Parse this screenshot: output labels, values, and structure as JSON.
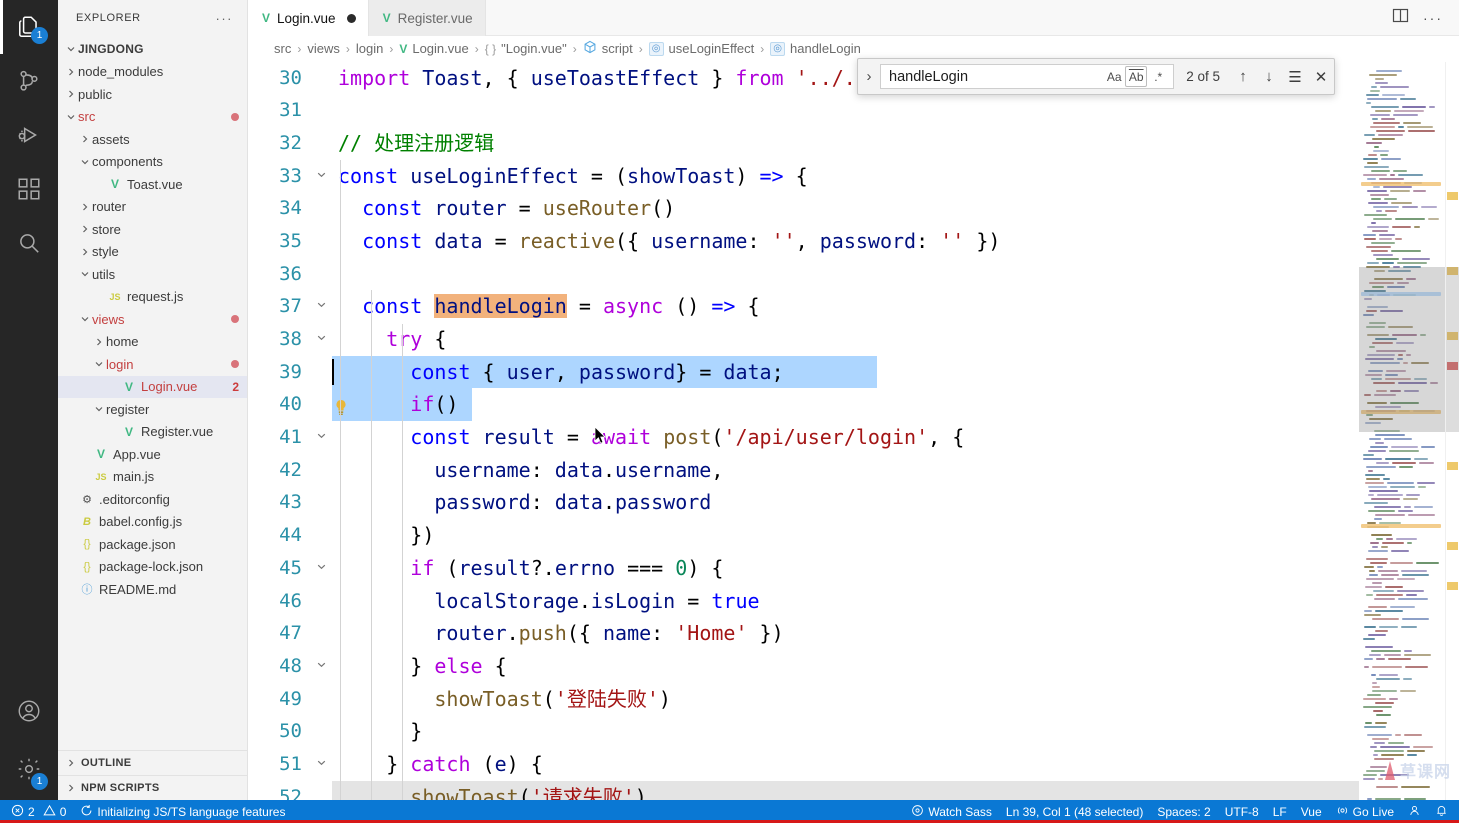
{
  "activitybar": {
    "items": [
      {
        "name": "explorer",
        "icon": "files-icon",
        "badge": "1",
        "active": true
      },
      {
        "name": "source-control",
        "icon": "source-control-icon",
        "badge": "",
        "active": false
      },
      {
        "name": "run-debug",
        "icon": "run-debug-icon",
        "badge": "",
        "active": false
      },
      {
        "name": "extensions",
        "icon": "extensions-icon",
        "badge": "",
        "active": false
      },
      {
        "name": "search",
        "icon": "search-icon",
        "badge": "",
        "active": false
      }
    ],
    "bottom": [
      {
        "name": "account",
        "icon": "account-icon",
        "badge": ""
      },
      {
        "name": "settings",
        "icon": "gear-icon",
        "badge": "1"
      }
    ]
  },
  "sidebar": {
    "title": "EXPLORER",
    "more_label": "···",
    "root": "JINGDONG",
    "tree": [
      {
        "label": "node_modules",
        "indent": 1,
        "arrow": "collapsed",
        "icon": "",
        "dirty": false,
        "selected": false,
        "count": ""
      },
      {
        "label": "public",
        "indent": 1,
        "arrow": "collapsed",
        "icon": "",
        "dirty": false,
        "selected": false,
        "count": ""
      },
      {
        "label": "src",
        "indent": 1,
        "arrow": "expanded",
        "icon": "",
        "dirty": true,
        "selected": false,
        "count": "",
        "modified": true
      },
      {
        "label": "assets",
        "indent": 2,
        "arrow": "collapsed",
        "icon": "",
        "dirty": false,
        "selected": false,
        "count": ""
      },
      {
        "label": "components",
        "indent": 2,
        "arrow": "expanded",
        "icon": "",
        "dirty": false,
        "selected": false,
        "count": ""
      },
      {
        "label": "Toast.vue",
        "indent": 3,
        "arrow": "none",
        "icon": "vue",
        "dirty": false,
        "selected": false,
        "count": ""
      },
      {
        "label": "router",
        "indent": 2,
        "arrow": "collapsed",
        "icon": "",
        "dirty": false,
        "selected": false,
        "count": ""
      },
      {
        "label": "store",
        "indent": 2,
        "arrow": "collapsed",
        "icon": "",
        "dirty": false,
        "selected": false,
        "count": ""
      },
      {
        "label": "style",
        "indent": 2,
        "arrow": "collapsed",
        "icon": "",
        "dirty": false,
        "selected": false,
        "count": ""
      },
      {
        "label": "utils",
        "indent": 2,
        "arrow": "expanded",
        "icon": "",
        "dirty": false,
        "selected": false,
        "count": ""
      },
      {
        "label": "request.js",
        "indent": 3,
        "arrow": "none",
        "icon": "js",
        "dirty": false,
        "selected": false,
        "count": ""
      },
      {
        "label": "views",
        "indent": 2,
        "arrow": "expanded",
        "icon": "",
        "dirty": false,
        "selected": false,
        "count": "",
        "modified": true
      },
      {
        "label": "home",
        "indent": 3,
        "arrow": "collapsed",
        "icon": "",
        "dirty": false,
        "selected": false,
        "count": ""
      },
      {
        "label": "login",
        "indent": 3,
        "arrow": "expanded",
        "icon": "",
        "dirty": false,
        "selected": false,
        "count": "",
        "modified": true
      },
      {
        "label": "Login.vue",
        "indent": 4,
        "arrow": "none",
        "icon": "vue",
        "dirty": true,
        "selected": true,
        "count": "2"
      },
      {
        "label": "register",
        "indent": 3,
        "arrow": "expanded",
        "icon": "",
        "dirty": false,
        "selected": false,
        "count": ""
      },
      {
        "label": "Register.vue",
        "indent": 4,
        "arrow": "none",
        "icon": "vue",
        "dirty": false,
        "selected": false,
        "count": ""
      },
      {
        "label": "App.vue",
        "indent": 2,
        "arrow": "none",
        "icon": "vue",
        "dirty": false,
        "selected": false,
        "count": ""
      },
      {
        "label": "main.js",
        "indent": 2,
        "arrow": "none",
        "icon": "js",
        "dirty": false,
        "selected": false,
        "count": ""
      },
      {
        "label": ".editorconfig",
        "indent": 1,
        "arrow": "none",
        "icon": "gear",
        "dirty": false,
        "selected": false,
        "count": ""
      },
      {
        "label": "babel.config.js",
        "indent": 1,
        "arrow": "none",
        "icon": "babel",
        "dirty": false,
        "selected": false,
        "count": ""
      },
      {
        "label": "package.json",
        "indent": 1,
        "arrow": "none",
        "icon": "json",
        "dirty": false,
        "selected": false,
        "count": ""
      },
      {
        "label": "package-lock.json",
        "indent": 1,
        "arrow": "none",
        "icon": "json",
        "dirty": false,
        "selected": false,
        "count": ""
      },
      {
        "label": "README.md",
        "indent": 1,
        "arrow": "none",
        "icon": "md",
        "dirty": false,
        "selected": false,
        "count": ""
      }
    ],
    "sections": [
      {
        "label": "OUTLINE"
      },
      {
        "label": "NPM SCRIPTS"
      }
    ]
  },
  "tabs": [
    {
      "label": "Login.vue",
      "icon": "vue-icon",
      "dirty": true,
      "active": true
    },
    {
      "label": "Register.vue",
      "icon": "vue-icon",
      "dirty": false,
      "active": false
    }
  ],
  "tab_actions": [
    {
      "name": "split-editor-icon"
    },
    {
      "name": "more-actions-icon"
    }
  ],
  "breadcrumb": [
    {
      "label": "src",
      "icon": ""
    },
    {
      "label": "views",
      "icon": ""
    },
    {
      "label": "login",
      "icon": ""
    },
    {
      "label": "Login.vue",
      "icon": "vue"
    },
    {
      "label": "\"Login.vue\"",
      "icon": "braces"
    },
    {
      "label": "script",
      "icon": "cube"
    },
    {
      "label": "useLoginEffect",
      "icon": "method"
    },
    {
      "label": "handleLogin",
      "icon": "method"
    }
  ],
  "find": {
    "query": "handleLogin",
    "placeholder": "Find",
    "match_case_label": "Aa",
    "whole_word_label": "Ab",
    "regex_label": ".*",
    "results": "2 of 5",
    "prev_label": "↑",
    "next_label": "↓",
    "selection_label": "☰",
    "close_label": "✕",
    "expand_label": "›"
  },
  "editor": {
    "first_line": 30,
    "lines": [
      {
        "n": 30,
        "fold": "",
        "text": "import Toast, { useToastEffect } from '../../components/Toast'"
      },
      {
        "n": 31,
        "fold": "",
        "text": ""
      },
      {
        "n": 32,
        "fold": "",
        "text": "// 处理注册逻辑"
      },
      {
        "n": 33,
        "fold": "open",
        "text": "const useLoginEffect = (showToast) => {"
      },
      {
        "n": 34,
        "fold": "",
        "text": "  const router = useRouter()"
      },
      {
        "n": 35,
        "fold": "",
        "text": "  const data = reactive({ username: '', password: '' })"
      },
      {
        "n": 36,
        "fold": "",
        "text": ""
      },
      {
        "n": 37,
        "fold": "open",
        "text": "  const handleLogin = async () => {"
      },
      {
        "n": 38,
        "fold": "open",
        "text": "    try {"
      },
      {
        "n": 39,
        "fold": "",
        "text": "      const { user, password} = data;"
      },
      {
        "n": 40,
        "fold": "",
        "text": "      if()"
      },
      {
        "n": 41,
        "fold": "open",
        "text": "      const result = await post('/api/user/login', {"
      },
      {
        "n": 42,
        "fold": "",
        "text": "        username: data.username,"
      },
      {
        "n": 43,
        "fold": "",
        "text": "        password: data.password"
      },
      {
        "n": 44,
        "fold": "",
        "text": "      })"
      },
      {
        "n": 45,
        "fold": "open",
        "text": "      if (result?.errno === 0) {"
      },
      {
        "n": 46,
        "fold": "",
        "text": "        localStorage.isLogin = true"
      },
      {
        "n": 47,
        "fold": "",
        "text": "        router.push({ name: 'Home' })"
      },
      {
        "n": 48,
        "fold": "open",
        "text": "      } else {"
      },
      {
        "n": 49,
        "fold": "",
        "text": "        showToast('登陆失败')"
      },
      {
        "n": 50,
        "fold": "",
        "text": "      }"
      },
      {
        "n": 51,
        "fold": "open",
        "text": "    } catch (e) {"
      },
      {
        "n": 52,
        "fold": "",
        "text": "      showToast('请求失败')"
      }
    ]
  },
  "statusbar": {
    "left": [
      {
        "name": "problems",
        "icon": "error-icon",
        "label": "2",
        "second_icon": "warning-icon",
        "second_label": "0"
      },
      {
        "name": "language-status",
        "icon": "sync-icon",
        "label": "Initializing JS/TS language features"
      }
    ],
    "right": [
      {
        "name": "watch-sass",
        "icon": "eye-icon",
        "label": "Watch Sass"
      },
      {
        "name": "cursor-position",
        "icon": "",
        "label": "Ln 39, Col 1 (48 selected)"
      },
      {
        "name": "indentation",
        "icon": "",
        "label": "Spaces: 2"
      },
      {
        "name": "encoding",
        "icon": "",
        "label": "UTF-8"
      },
      {
        "name": "eol",
        "icon": "",
        "label": "LF"
      },
      {
        "name": "language-mode",
        "icon": "",
        "label": "Vue"
      },
      {
        "name": "go-live",
        "icon": "broadcast-icon",
        "label": "Go Live"
      },
      {
        "name": "remote",
        "icon": "person-icon",
        "label": ""
      },
      {
        "name": "notifications",
        "icon": "bell-icon",
        "label": ""
      }
    ]
  },
  "colors": {
    "accent": "#0a78d4",
    "activitybar_bg": "#262626",
    "sidebar_bg": "#f3f3f3",
    "editor_bg": "#ffffff",
    "selection": "#add6ff",
    "find_match": "#f8c9a4",
    "modified_dot": "#d9737a",
    "error_red": "#cc3c3c",
    "vue_green": "#41b883",
    "line_number": "#2b91a8"
  }
}
